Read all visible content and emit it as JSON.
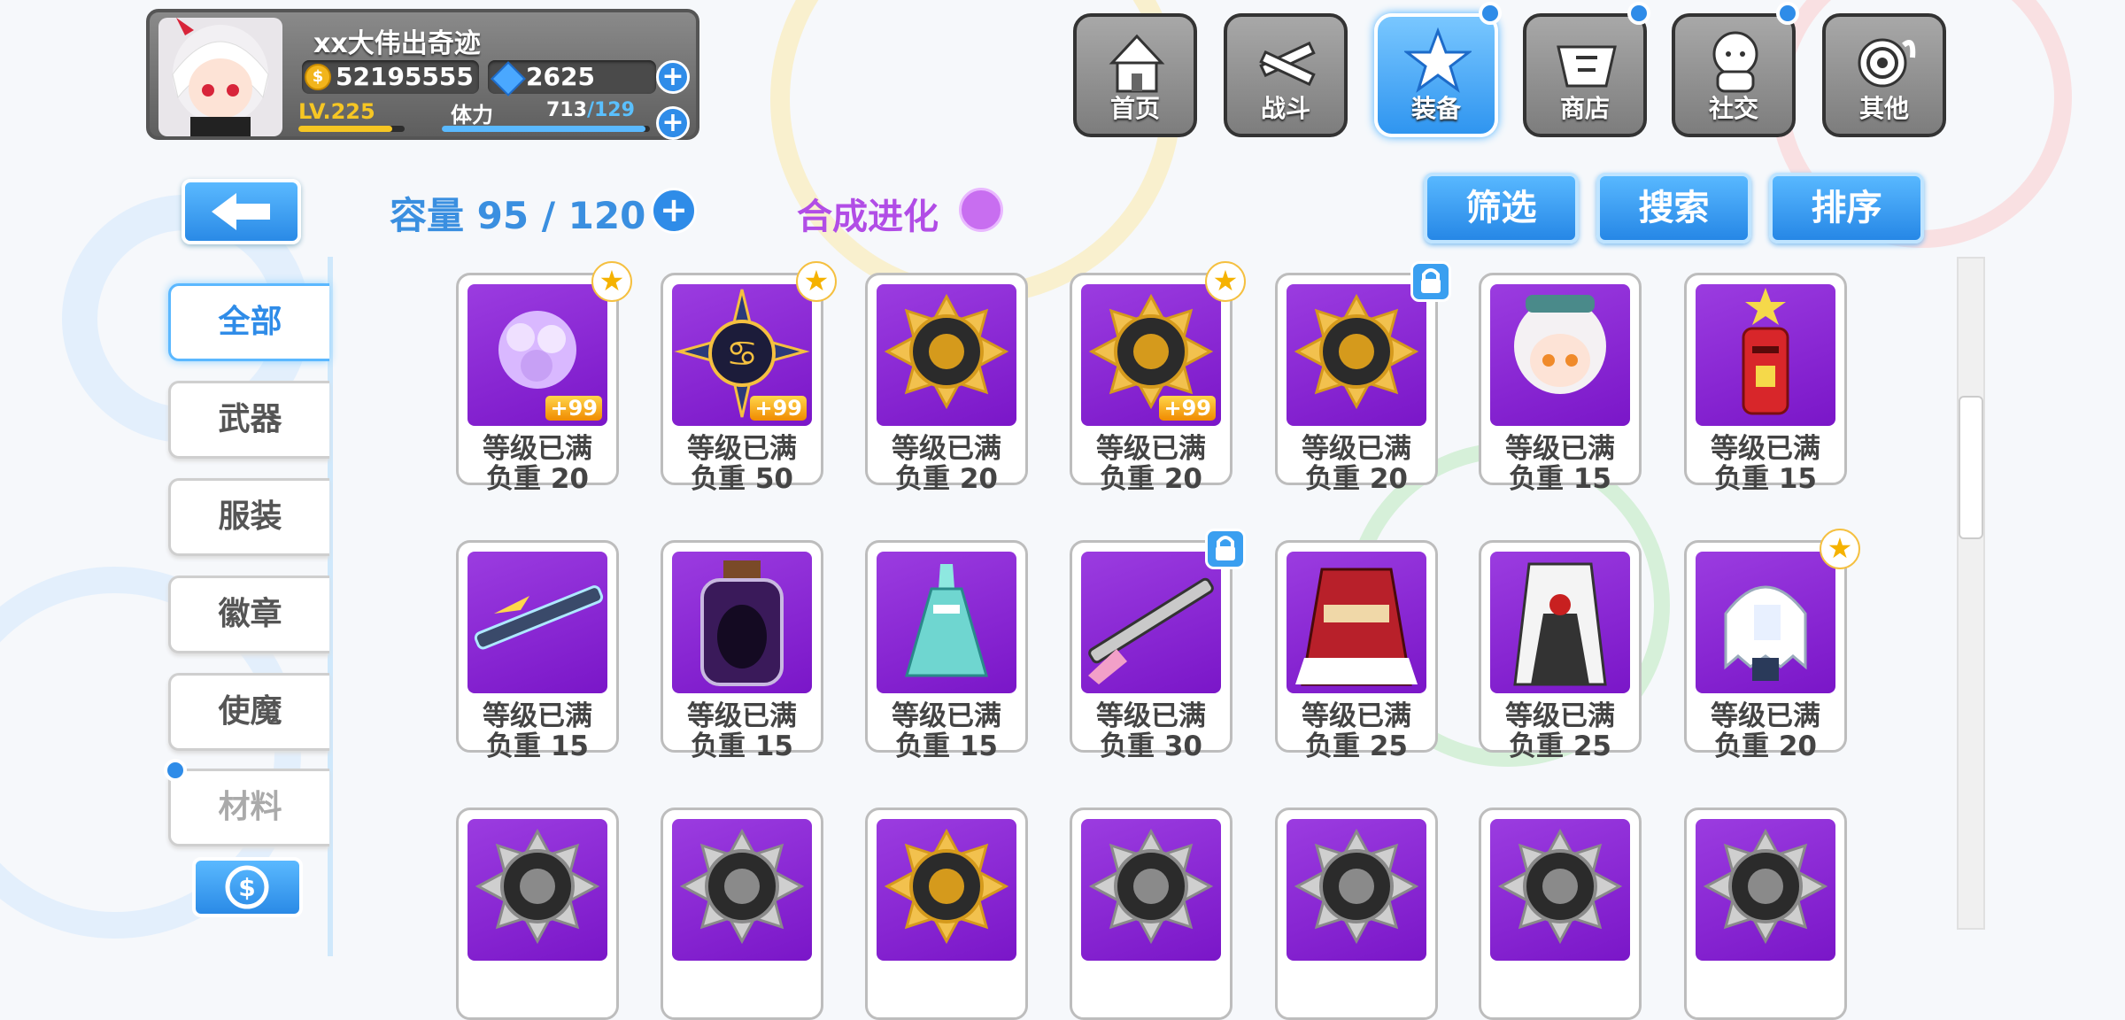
{
  "profile": {
    "name": "xx大伟出奇迹",
    "coins": "52195555",
    "gems": "2625",
    "level": "LV.225",
    "stamina_label": "体力",
    "stamina_current": "713",
    "stamina_max": "/129",
    "level_progress": 0.88,
    "stamina_progress": 0.98
  },
  "nav": [
    {
      "label": "首页",
      "icon": "house-icon",
      "active": false,
      "dot": false
    },
    {
      "label": "战斗",
      "icon": "crossed-guns-icon",
      "active": false,
      "dot": false
    },
    {
      "label": "装备",
      "icon": "star-gun-icon",
      "active": true,
      "dot": true
    },
    {
      "label": "商店",
      "icon": "basket-icon",
      "active": false,
      "dot": true
    },
    {
      "label": "社交",
      "icon": "social-icon",
      "active": false,
      "dot": true
    },
    {
      "label": "其他",
      "icon": "settings-icon",
      "active": false,
      "dot": false
    }
  ],
  "capacity": "容量 95 / 120",
  "synthesis": "合成进化",
  "actions": {
    "filter": "筛选",
    "search": "搜索",
    "sort": "排序"
  },
  "categories": [
    {
      "label": "全部",
      "active": true
    },
    {
      "label": "武器",
      "active": false
    },
    {
      "label": "服装",
      "active": false
    },
    {
      "label": "徽章",
      "active": false
    },
    {
      "label": "使魔",
      "active": false
    },
    {
      "label": "材料",
      "active": false
    }
  ],
  "items": [
    {
      "status": "等级已满",
      "weight": "负重 20",
      "badge": "star",
      "plus": "+99",
      "art": "flower"
    },
    {
      "status": "等级已满",
      "weight": "负重 50",
      "badge": "star",
      "plus": "+99",
      "art": "zodiac-cancer"
    },
    {
      "status": "等级已满",
      "weight": "负重 20",
      "badge": "none",
      "plus": "",
      "art": "gold-medal"
    },
    {
      "status": "等级已满",
      "weight": "负重 20",
      "badge": "star",
      "plus": "+99",
      "art": "gold-medal"
    },
    {
      "status": "等级已满",
      "weight": "负重 20",
      "badge": "lock",
      "plus": "",
      "art": "gold-medal"
    },
    {
      "status": "等级已满",
      "weight": "负重 15",
      "badge": "none",
      "plus": "",
      "art": "girl"
    },
    {
      "status": "等级已满",
      "weight": "负重 15",
      "badge": "none",
      "plus": "",
      "art": "mailbox"
    },
    {
      "status": "等级已满",
      "weight": "负重 15",
      "badge": "none",
      "plus": "",
      "art": "sword"
    },
    {
      "status": "等级已满",
      "weight": "负重 15",
      "badge": "none",
      "plus": "",
      "art": "jar"
    },
    {
      "status": "等级已满",
      "weight": "负重 15",
      "badge": "none",
      "plus": "",
      "art": "dress"
    },
    {
      "status": "等级已满",
      "weight": "负重 30",
      "badge": "lock",
      "plus": "",
      "art": "rifle"
    },
    {
      "status": "等级已满",
      "weight": "负重 25",
      "badge": "none",
      "plus": "",
      "art": "red-outfit"
    },
    {
      "status": "等级已满",
      "weight": "负重 25",
      "badge": "none",
      "plus": "",
      "art": "white-outfit"
    },
    {
      "status": "等级已满",
      "weight": "负重 20",
      "badge": "star",
      "plus": "",
      "art": "ghost"
    },
    {
      "status": "",
      "weight": "",
      "badge": "none",
      "plus": "",
      "art": "silver-medal"
    },
    {
      "status": "",
      "weight": "",
      "badge": "none",
      "plus": "",
      "art": "silver-medal"
    },
    {
      "status": "",
      "weight": "",
      "badge": "none",
      "plus": "",
      "art": "gold-medal"
    },
    {
      "status": "",
      "weight": "",
      "badge": "none",
      "plus": "",
      "art": "silver-medal"
    },
    {
      "status": "",
      "weight": "",
      "badge": "none",
      "plus": "",
      "art": "silver-medal"
    },
    {
      "status": "",
      "weight": "",
      "badge": "none",
      "plus": "",
      "art": "silver-medal"
    },
    {
      "status": "",
      "weight": "",
      "badge": "none",
      "plus": "",
      "art": "silver-medal"
    }
  ]
}
